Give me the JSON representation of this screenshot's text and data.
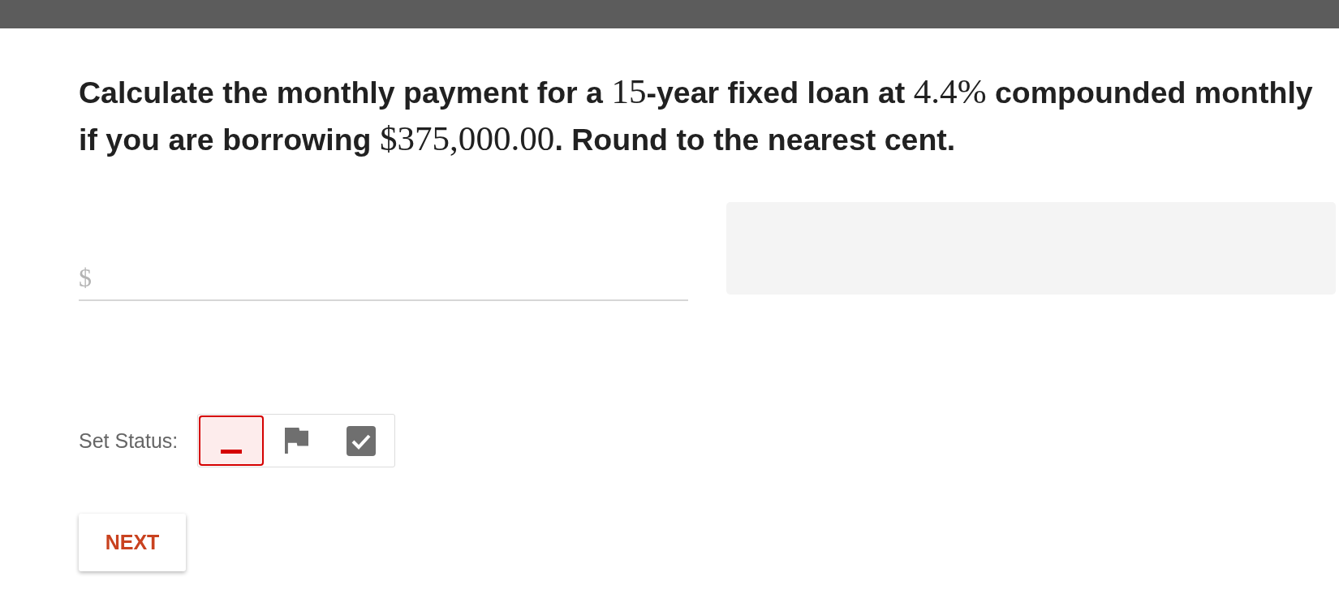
{
  "question": {
    "segments": [
      {
        "kind": "text",
        "text": "Calculate the monthly payment for a "
      },
      {
        "kind": "math",
        "text": "15"
      },
      {
        "kind": "text",
        "text": "-year fixed loan at "
      },
      {
        "kind": "math",
        "text": "4.4%"
      },
      {
        "kind": "text",
        "text": " compounded monthly if you are borrowing "
      },
      {
        "kind": "math",
        "text": "$375,000.00"
      },
      {
        "kind": "text",
        "text": ". Round to the nearest cent."
      }
    ]
  },
  "answer": {
    "placeholder": "$"
  },
  "status": {
    "label": "Set Status:",
    "options": [
      {
        "kind": "none",
        "selected": true
      },
      {
        "kind": "flag",
        "selected": false
      },
      {
        "kind": "done",
        "selected": false
      }
    ]
  },
  "buttons": [
    {
      "label": "NEXT"
    }
  ]
}
